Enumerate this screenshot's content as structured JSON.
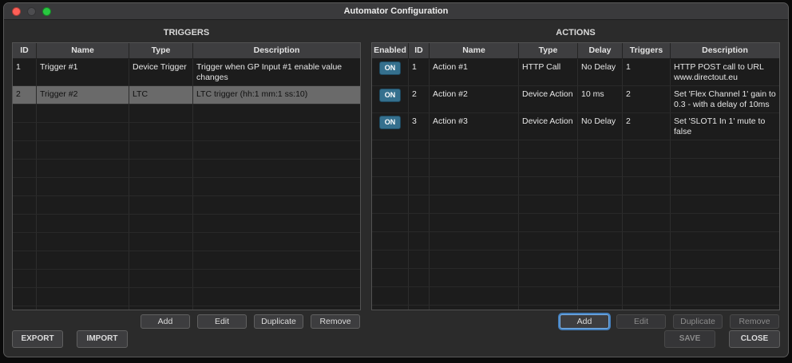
{
  "window": {
    "title": "Automator Configuration"
  },
  "colors": {
    "accent": "#4a90d9",
    "on_button": "#35708e",
    "traffic_close": "#ff5f57",
    "traffic_minimize": "#4d4d50",
    "traffic_zoom": "#28c840"
  },
  "triggers": {
    "title": "TRIGGERS",
    "columns": [
      "ID",
      "Name",
      "Type",
      "Description"
    ],
    "rows": [
      {
        "id": "1",
        "name": "Trigger #1",
        "type": "Device Trigger",
        "description": "Trigger when GP Input #1 enable value changes",
        "selected": false
      },
      {
        "id": "2",
        "name": "Trigger #2",
        "type": "LTC",
        "description": "LTC trigger (hh:1 mm:1 ss:10)",
        "selected": true
      }
    ],
    "buttons": {
      "add": "Add",
      "edit": "Edit",
      "duplicate": "Duplicate",
      "remove": "Remove"
    }
  },
  "actions": {
    "title": "ACTIONS",
    "columns": [
      "Enabled",
      "ID",
      "Name",
      "Type",
      "Delay",
      "Triggers",
      "Description"
    ],
    "rows": [
      {
        "enabled": "ON",
        "id": "1",
        "name": "Action #1",
        "type": "HTTP Call",
        "delay": "No Delay",
        "triggers": "1",
        "description": "HTTP POST call to URL www.directout.eu"
      },
      {
        "enabled": "ON",
        "id": "2",
        "name": "Action #2",
        "type": "Device Action",
        "delay": "10 ms",
        "triggers": "2",
        "description": "Set 'Flex Channel 1' gain to 0.3 - with a delay of 10ms"
      },
      {
        "enabled": "ON",
        "id": "3",
        "name": "Action #3",
        "type": "Device Action",
        "delay": "No Delay",
        "triggers": "2",
        "description": "Set 'SLOT1 In 1' mute to false"
      }
    ],
    "buttons": {
      "add": "Add",
      "edit": "Edit",
      "duplicate": "Duplicate",
      "remove": "Remove"
    }
  },
  "footer": {
    "export": "EXPORT",
    "import": "IMPORT",
    "save": "SAVE",
    "close": "CLOSE"
  }
}
